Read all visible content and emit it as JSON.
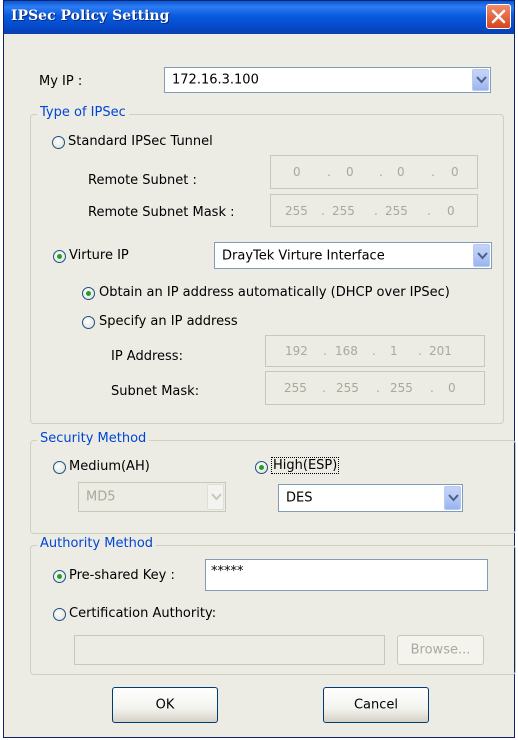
{
  "window": {
    "title": "IPSec Policy Setting"
  },
  "my_ip": {
    "label": "My IP :",
    "value": "172.16.3.100"
  },
  "type_group": {
    "legend": "Type of IPSec",
    "standard_label": "Standard IPSec Tunnel",
    "remote_subnet_label": "Remote Subnet :",
    "remote_subnet": [
      "0",
      "0",
      "0",
      "0"
    ],
    "remote_mask_label": "Remote Subnet Mask :",
    "remote_mask": [
      "255",
      "255",
      "255",
      "0"
    ],
    "virtual_label": "Virture IP",
    "virtual_interface": "DrayTek Virture Interface",
    "obtain_label": "Obtain an IP address automatically (DHCP over IPSec)",
    "specify_label": "Specify an IP address",
    "ip_address_label": "IP Address:",
    "ip_address": [
      "192",
      "168",
      "1",
      "201"
    ],
    "subnet_mask_label": "Subnet Mask:",
    "subnet_mask": [
      "255",
      "255",
      "255",
      "0"
    ]
  },
  "security": {
    "legend": "Security Method",
    "medium_label": "Medium(AH)",
    "high_label": "High(ESP)",
    "medium_algo": "MD5",
    "high_algo": "DES"
  },
  "authority": {
    "legend": "Authority Method",
    "psk_label": "Pre-shared Key :",
    "psk_value": "*****",
    "cert_label": "Certification Authority:",
    "browse_label": "Browse..."
  },
  "buttons": {
    "ok": "OK",
    "cancel": "Cancel"
  },
  "colors": {
    "title_bar": "#0a5ae0",
    "group_legend": "#0046d5",
    "radio_dot": "#21a121",
    "dialog_bg": "#ecebe4"
  }
}
